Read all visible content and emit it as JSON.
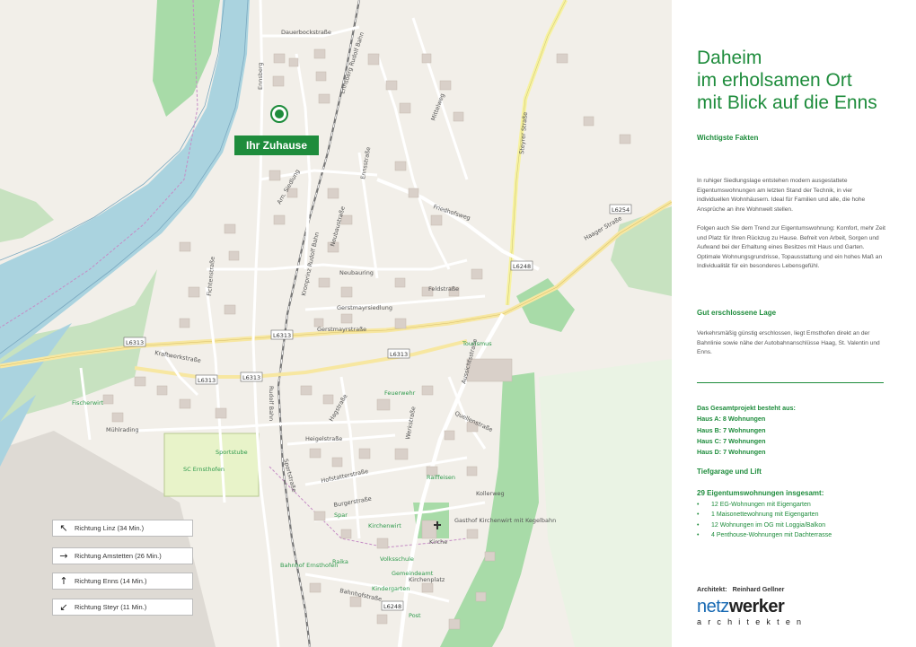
{
  "map": {
    "home_label": "Ihr Zuhause",
    "road_shields": [
      "L6254",
      "L6248",
      "L6313",
      "L6313",
      "L6313",
      "L6313",
      "L6313",
      "L6248"
    ],
    "street_labels": [
      "Dauerbockstraße",
      "Ennsberg",
      "Ennsberg Rudolf Bahn",
      "Kronprinz Rudolf Bahn",
      "Mittelweg",
      "Steyrer Straße",
      "Haager Straße",
      "Ennsstraße",
      "Arn. Siedlung",
      "Neubaustraße",
      "Neubauring",
      "Feldstraße",
      "Friedhofsweg",
      "Gerstmayrstraße",
      "Gerstmayrsiedlung",
      "Fichtenstraße",
      "Kraftwerkstraße",
      "Mühlrading",
      "Heigelstraße",
      "Hagstraße",
      "Hofstatterstraße",
      "Bahnhofstraße",
      "Burgerstraße",
      "Kirchenplatz",
      "Aussichtsstraße",
      "Quellenstraße",
      "Werkstraße",
      "Kollerweg",
      "Sportstraße",
      "Rudolf Bahn"
    ],
    "poi_labels": [
      "Fischerwirt",
      "Sportstube",
      "SC Ernsthofen",
      "Raiffeisen",
      "Kirchenwirt",
      "Gasthof Kirchenwirt mit Kegelbahn",
      "Kirche",
      "Volksschule",
      "Bahnhof Ernsthofen",
      "Gemeindeamt",
      "Post",
      "Spar",
      "Feuerwehr",
      "Raika",
      "Kindergarten",
      "Tourismus"
    ],
    "directions": [
      {
        "label": "Richtung Linz (34 Min.)",
        "arrow": "↖"
      },
      {
        "label": "Richtung Amstetten (26 Min.)",
        "arrow": "→"
      },
      {
        "label": "Richtung Enns (14 Min.)",
        "arrow": "↑"
      },
      {
        "label": "Richtung Steyr (11 Min.)",
        "arrow": "↙"
      }
    ]
  },
  "panel": {
    "headline": [
      "Daheim",
      "im erholsamen Ort",
      "mit Blick auf die Enns"
    ],
    "facts_title": "Wichtigste Fakten",
    "intro_paragraphs": [
      "In ruhiger Siedlungslage entstehen modern ausgestattete Eigentumswohnungen am letzten Stand der Technik, in vier individuellen Wohnhäusern. Ideal für Familien und alle, die hohe Ansprüche an ihre Wohnwelt stellen.",
      "Folgen auch Sie dem Trend zur Eigentumswohnung: Komfort, mehr Zeit und Platz für Ihren Rückzug zu Hause. Befreit von Arbeit, Sorgen und Aufwand bei der Erhaltung eines Besitzes mit Haus und Garten.",
      "Optimale Wohnungsgrundrisse, Topausstattung und ein hohes Maß an Individualität für ein besonderes Lebensgefühl."
    ],
    "location_title": "Gut erschlossene Lage",
    "location_text": "Verkehrsmäßig günstig erschlossen, liegt Ernsthofen direkt an der Bahnlinie sowie nähe der Autobahnanschlüsse Haag, St. Valentin und Enns.",
    "project_lines": [
      "Das Gesamtprojekt besteht aus:",
      "Haus A: 8 Wohnungen",
      "Haus B: 7 Wohnungen",
      "Haus C: 7 Wohnungen",
      "Haus D: 7 Wohnungen"
    ],
    "garage_title": "Tiefgarage und Lift",
    "units_title": "29 Eigentumswohnungen insgesamt:",
    "units": [
      "12 EG-Wohnungen mit Eigengarten",
      "1 Maisonettewohnung mit Eigengarten",
      "12 Wohnungen im OG mit Loggia/Balkon",
      "4 Penthouse-Wohnungen mit Dachterrasse"
    ],
    "bullet": "•",
    "architect_label": "Architekt:",
    "architect_name": "Reinhard Gellner",
    "logo_main_a": "netz",
    "logo_main_b": "werker",
    "logo_sub": "architekten"
  },
  "colors": {
    "accent_green": "#1e8c3c",
    "water": "#aad3df",
    "park": "#a8dba8",
    "land": "#f2efe9",
    "building": "#d9d0c9",
    "logo_blue": "#1769b3"
  }
}
